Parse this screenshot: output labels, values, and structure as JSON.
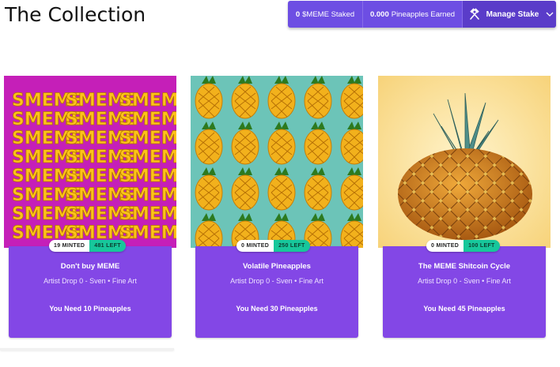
{
  "page": {
    "title": "The Collection"
  },
  "stake": {
    "staked_value": "0",
    "staked_label": "$MEME Staked",
    "earned_value": "0.000",
    "earned_label": "Pineapples Earned",
    "manage_label": "Manage Stake",
    "manage_icon": "hammer-icon",
    "chevron_icon": "chevron-down-icon"
  },
  "colors": {
    "stake_bar": "#6d4ee3",
    "manage_bg": "#5a3cc9",
    "card_body": "#8347e6",
    "badge_left": "#17c79b"
  },
  "cards": [
    {
      "title": "Don't buy MEME",
      "subtitle": "Artist Drop 0 - Sven • Fine Art",
      "need": "You Need 10 Pineapples",
      "minted": "19 MINTED",
      "left": "481 LEFT",
      "image": "meme-text-art"
    },
    {
      "title": "Volatile Pineapples",
      "subtitle": "Artist Drop 0 - Sven • Fine Art",
      "need": "You Need 30 Pineapples",
      "minted": "0 MINTED",
      "left": "250 LEFT",
      "image": "pineapple-pattern"
    },
    {
      "title": "The MEME Shitcoin Cycle",
      "subtitle": "Artist Drop 0 - Sven • Fine Art",
      "need": "You Need 45 Pineapples",
      "minted": "0 MINTED",
      "left": "100 LEFT",
      "image": "pineapple-photo"
    }
  ]
}
